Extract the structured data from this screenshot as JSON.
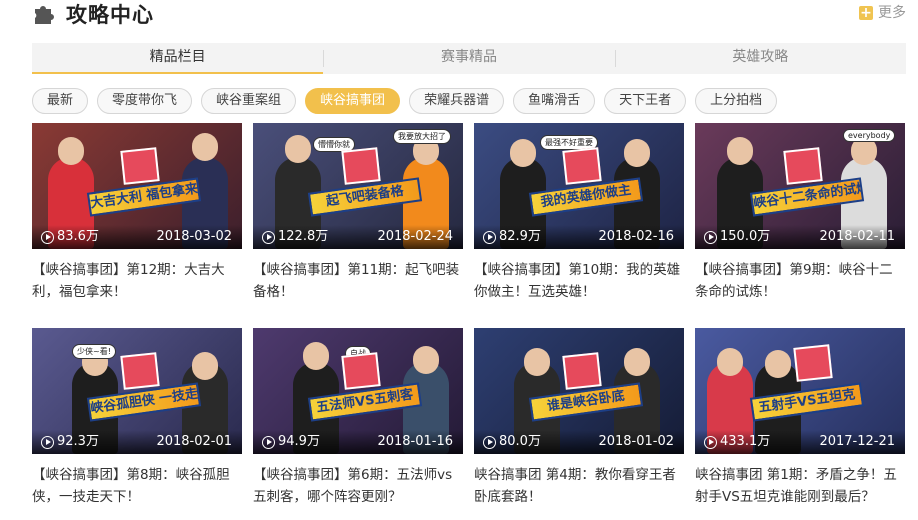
{
  "header": {
    "title": "攻略中心",
    "more_label": "更多"
  },
  "tabs": [
    {
      "label": "精品栏目",
      "active": true
    },
    {
      "label": "赛事精品",
      "active": false
    },
    {
      "label": "英雄攻略",
      "active": false
    }
  ],
  "filters": [
    {
      "label": "最新",
      "active": false
    },
    {
      "label": "零度带你飞",
      "active": false
    },
    {
      "label": "峡谷重案组",
      "active": false
    },
    {
      "label": "峡谷搞事团",
      "active": true
    },
    {
      "label": "荣耀兵器谱",
      "active": false
    },
    {
      "label": "鱼嘴滑舌",
      "active": false
    },
    {
      "label": "天下王者",
      "active": false
    },
    {
      "label": "上分拍档",
      "active": false
    }
  ],
  "videos": [
    {
      "views": "83.6万",
      "date": "2018-03-02",
      "title": "【峡谷搞事团】第12期：大吉大利，福包拿来！",
      "thumb_text": "大吉大利 福包拿来",
      "bg": "#7a2a2a"
    },
    {
      "views": "122.8万",
      "date": "2018-02-24",
      "title": "【峡谷搞事团】第11期：起飞吧装备格！",
      "thumb_text": "起飞吧装备格",
      "bg": "#3a3f6a"
    },
    {
      "views": "82.9万",
      "date": "2018-02-16",
      "title": "【峡谷搞事团】第10期：我的英雄你做主！互选英雄！",
      "thumb_text": "我的英雄你做主",
      "bg": "#2e3c6e"
    },
    {
      "views": "150.0万",
      "date": "2018-02-11",
      "title": "【峡谷搞事团】第9期：峡谷十二条命的试炼！",
      "thumb_text": "峡谷十二条命的试炼",
      "bg": "#5a2e4a"
    },
    {
      "views": "92.3万",
      "date": "2018-02-01",
      "title": "【峡谷搞事团】第8期：峡谷孤胆侠，一技走天下！",
      "thumb_text": "峡谷孤胆侠 一技走天下",
      "bg": "#4a4a7a"
    },
    {
      "views": "94.9万",
      "date": "2018-01-16",
      "title": "【峡谷搞事团】第6期：五法师vs五刺客，哪个阵容更刚？",
      "thumb_text": "五法师VS五刺客",
      "bg": "#3e2a5a"
    },
    {
      "views": "80.0万",
      "date": "2018-01-02",
      "title": "峡谷搞事团 第4期：教你看穿王者卧底套路！",
      "thumb_text": "谁是峡谷卧底",
      "bg": "#24335e"
    },
    {
      "views": "433.1万",
      "date": "2017-12-21",
      "title": "峡谷搞事团 第1期：矛盾之争！五射手VS五坦克谁能刚到最后？",
      "thumb_text": "五射手VS五坦克",
      "bg": "#3a4a8a"
    }
  ],
  "icons": {
    "logo": "puzzle-icon",
    "more": "plus-icon",
    "views": "play-icon"
  },
  "colors": {
    "accent": "#f2c04c",
    "tab_bg": "#f3f3f3"
  }
}
